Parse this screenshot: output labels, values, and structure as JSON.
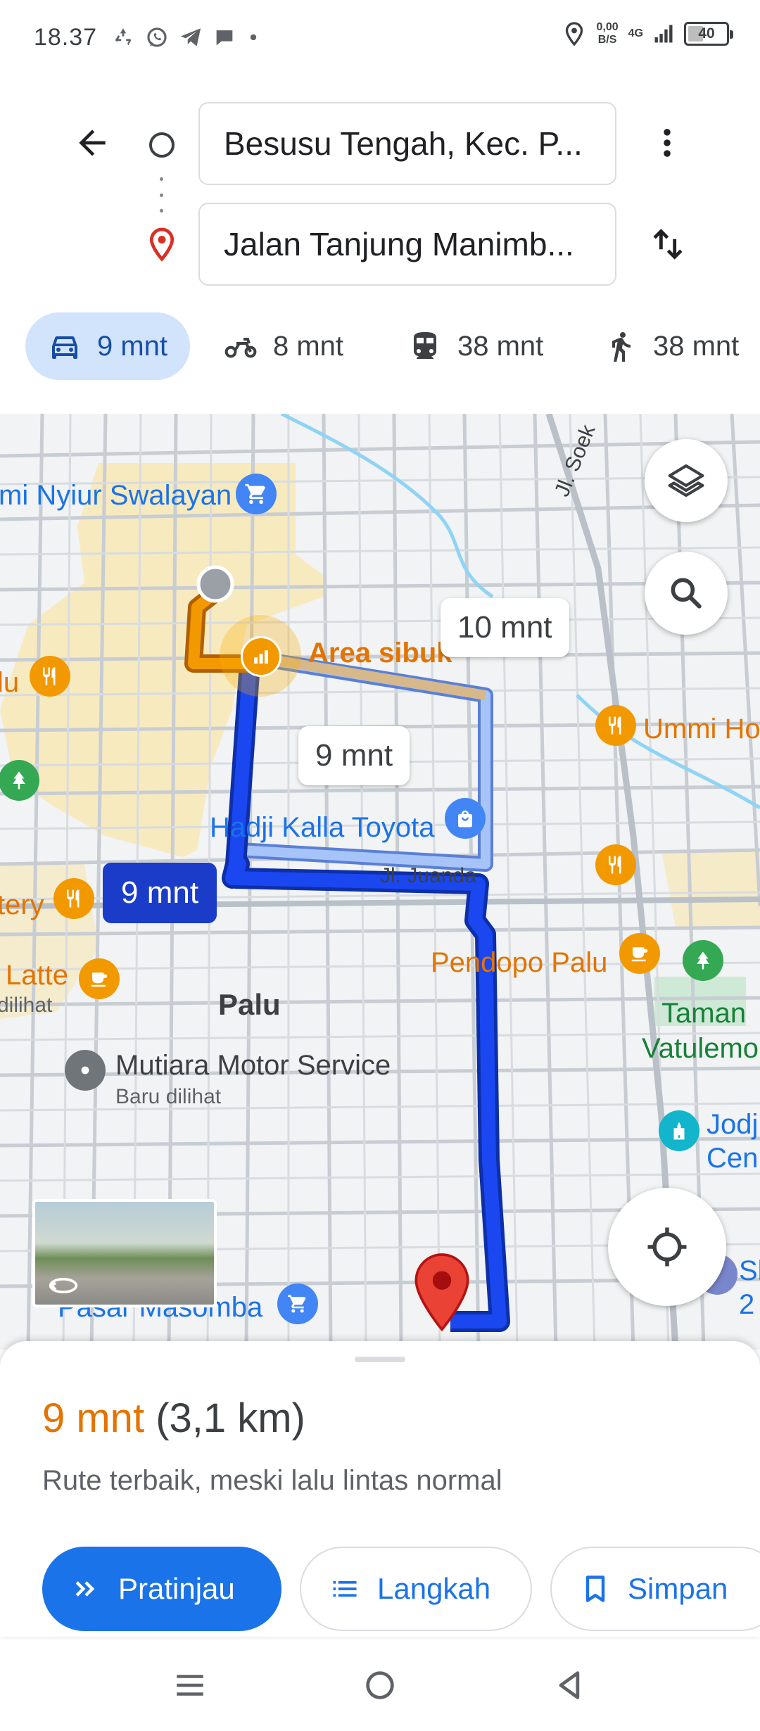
{
  "status_bar": {
    "time": "18.37",
    "net_speed_value": "0,00",
    "net_speed_unit": "B/S",
    "network": "4G",
    "battery": "40",
    "battery_level": 0.4
  },
  "directions": {
    "origin": "Besusu Tengah, Kec. P...",
    "destination": "Jalan Tanjung Manimb..."
  },
  "modes": [
    {
      "name": "car",
      "label": "9 mnt",
      "active": true
    },
    {
      "name": "motorcycle",
      "label": "8 mnt",
      "active": false
    },
    {
      "name": "transit",
      "label": "38 mnt",
      "active": false
    },
    {
      "name": "walk",
      "label": "38 mnt",
      "active": false
    }
  ],
  "map": {
    "labels": {
      "nyiur": "mi Nyiur Swalayan",
      "area_sibuk": "Area sibuk",
      "alt1_eta": "10 mnt",
      "alt2_eta": "9 mnt",
      "main_eta": "9 mnt",
      "hadji_kalla": "Hadji Kalla Toyota",
      "jl_juanda": "Jl. Juanda",
      "jl_soekarno": "Jl. Soek",
      "ummi": "Ummi Ho",
      "lu": "lu",
      "tery": "tery",
      "latte": "Latte",
      "dilihat_left": "dilihat",
      "palu": "Palu",
      "pendopo": "Pendopo Palu",
      "taman_1": "Taman",
      "taman_2": "Vatulemo",
      "mutiara": "Mutiara Motor Service",
      "mutiara_sub": "Baru dilihat",
      "jodj_1": "Jodj",
      "jodj_2": "Cen",
      "sl_1": "Sl",
      "sl_2": "2",
      "masomba": "Pasar Masomba"
    },
    "colors": {
      "route_primary": "#1a47f0",
      "route_alt": "#8ab4f8",
      "traffic": "#f29900",
      "busy_area": "#fde293"
    }
  },
  "sheet": {
    "time": "9 mnt",
    "distance": "(3,1 km)",
    "description": "Rute terbaik, meski lalu lintas normal",
    "preview_label": "Pratinjau",
    "steps_label": "Langkah",
    "save_label": "Simpan"
  }
}
